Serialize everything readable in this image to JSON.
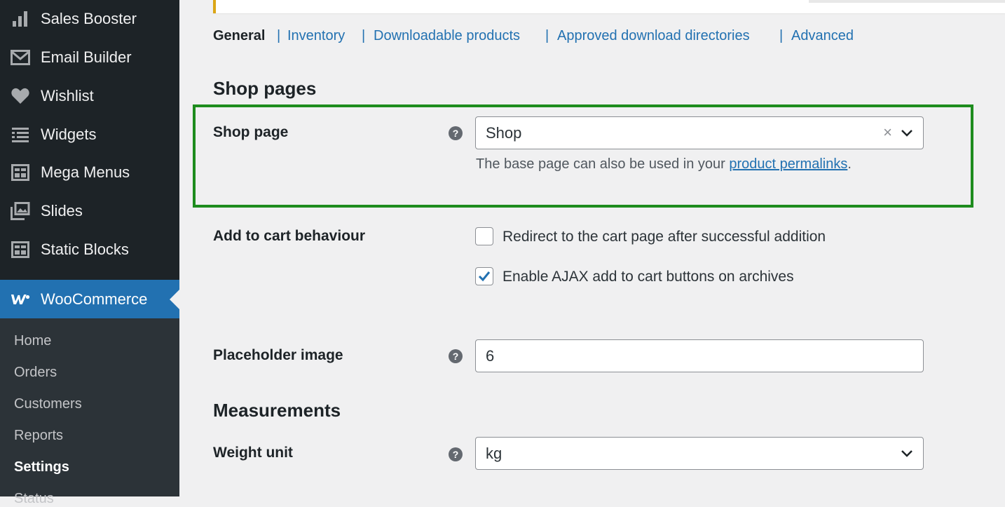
{
  "sidebar": {
    "items": [
      {
        "label": "Sales Booster",
        "icon": "bar-chart-icon"
      },
      {
        "label": "Email Builder",
        "icon": "envelope-icon"
      },
      {
        "label": "Wishlist",
        "icon": "heart-icon"
      },
      {
        "label": "Widgets",
        "icon": "list-icon"
      },
      {
        "label": "Mega Menus",
        "icon": "grid-icon"
      },
      {
        "label": "Slides",
        "icon": "images-icon"
      },
      {
        "label": "Static Blocks",
        "icon": "grid-icon"
      }
    ],
    "active": {
      "label": "WooCommerce",
      "icon": "woo-icon"
    },
    "submenu": [
      "Home",
      "Orders",
      "Customers",
      "Reports",
      "Settings",
      "Status"
    ],
    "current_submenu": "Settings"
  },
  "subnav": {
    "items": [
      "General",
      "Inventory",
      "Downloadable products",
      "Approved download directories",
      "Advanced"
    ],
    "current": "General",
    "separator": "|"
  },
  "sections": {
    "shop_pages": "Shop pages",
    "measurements": "Measurements"
  },
  "fields": {
    "shop_page": {
      "label": "Shop page",
      "value": "Shop",
      "clear_glyph": "×",
      "description_prefix": "The base page can also be used in your ",
      "description_link": "product permalinks",
      "description_suffix": "."
    },
    "add_to_cart": {
      "label": "Add to cart behaviour",
      "options": [
        {
          "label": "Redirect to the cart page after successful addition",
          "checked": false
        },
        {
          "label": "Enable AJAX add to cart buttons on archives",
          "checked": true
        }
      ]
    },
    "placeholder_image": {
      "label": "Placeholder image",
      "value": "6"
    },
    "weight_unit": {
      "label": "Weight unit",
      "value": "kg"
    },
    "help_glyph": "?"
  },
  "colors": {
    "sidebar_bg": "#1d2327",
    "submenu_bg": "#2c3338",
    "accent": "#2271b1",
    "highlight_border": "#1e8c1e",
    "notice_border": "#dba617"
  }
}
